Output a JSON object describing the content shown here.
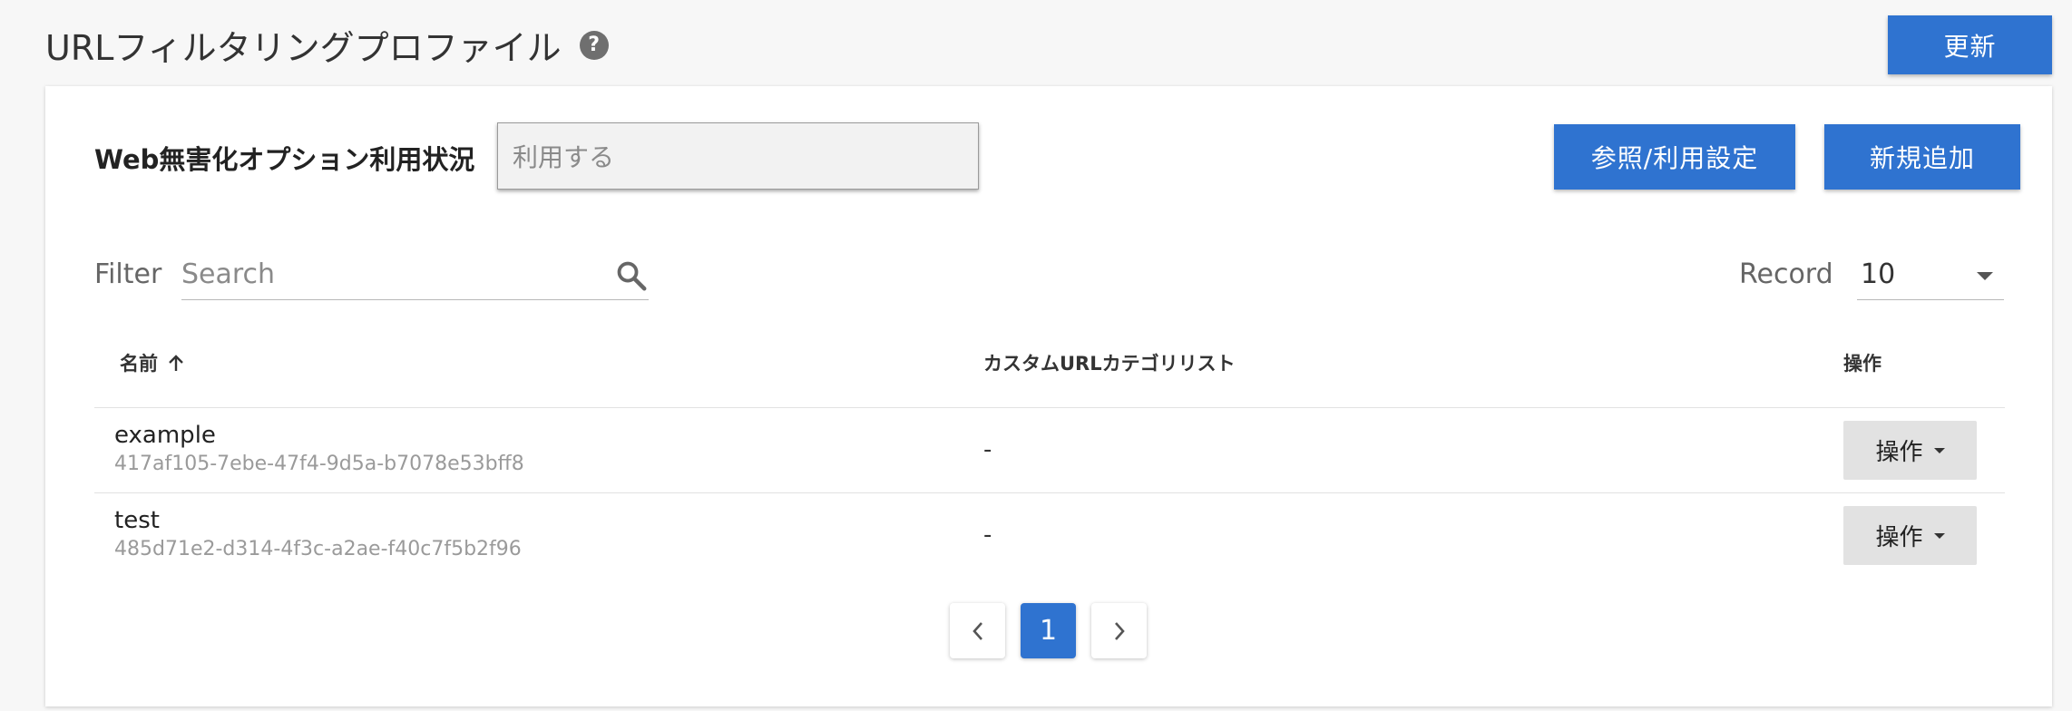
{
  "header": {
    "title": "URLフィルタリングプロファイル",
    "help_icon": "?",
    "refresh_label": "更新"
  },
  "options": {
    "label": "Web無害化オプション利用状況",
    "value": "利用する",
    "reference_label": "参照/利用設定",
    "add_label": "新規追加"
  },
  "filter": {
    "label": "Filter",
    "placeholder": "Search",
    "record_label": "Record",
    "record_value": "10"
  },
  "table": {
    "columns": [
      "名前",
      "カスタムURLカテゴリリスト",
      "操作"
    ],
    "rows": [
      {
        "name": "example",
        "id": "417af105-7ebe-47f4-9d5a-b7078e53bff8",
        "category": "-",
        "action": "操作"
      },
      {
        "name": "test",
        "id": "485d71e2-d314-4f3c-a2ae-f40c7f5b2f96",
        "category": "-",
        "action": "操作"
      }
    ]
  },
  "pagination": {
    "current": "1"
  },
  "colors": {
    "primary": "#2f73d0",
    "background": "#f7f7f7"
  }
}
